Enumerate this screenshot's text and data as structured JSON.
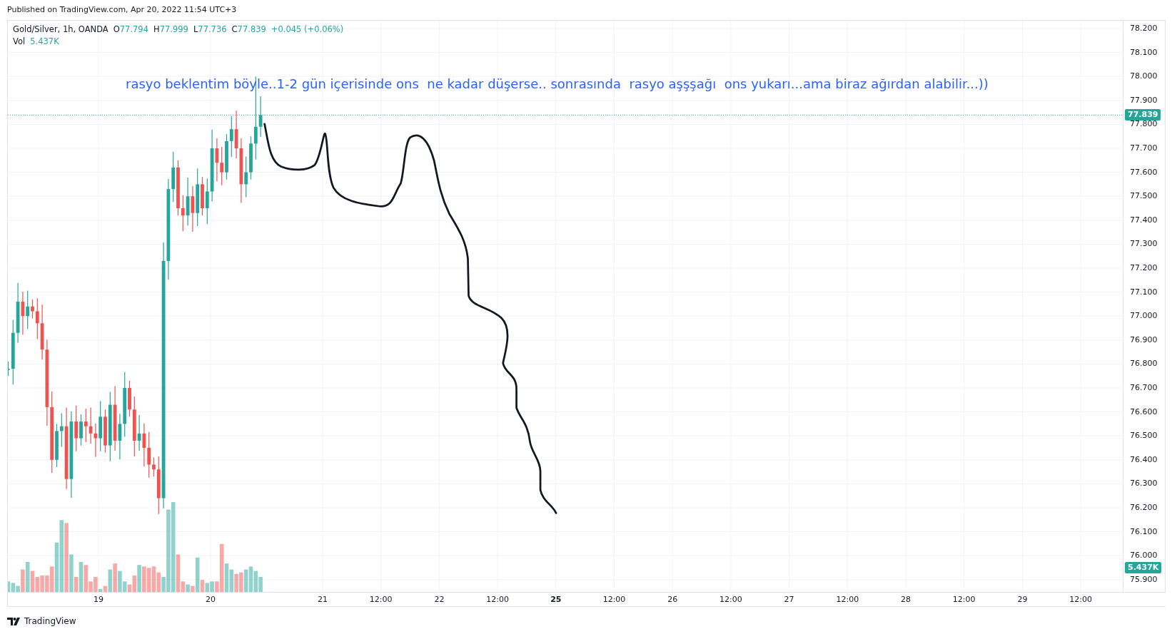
{
  "published": "Published on TradingView.com, Apr 20, 2022 11:54 UTC+3",
  "legend": {
    "symbol": "Gold/Silver, 1h, OANDA",
    "ohlc": [
      {
        "label": "O",
        "value": "77.794"
      },
      {
        "label": "H",
        "value": "77.999"
      },
      {
        "label": "L",
        "value": "77.736"
      },
      {
        "label": "C",
        "value": "77.839"
      }
    ],
    "change": "+0.045 (+0.06%)",
    "volume_label": "Vol",
    "volume_value": "5.437K"
  },
  "annotation": "rasyo beklentim böyle..1-2 gün içerisinde ons  ne kadar düşerse.. sonrasında  rasyo aşşşağı  ons yukarı...ama biraz ağırdan alabilir...))",
  "price_axis": [
    "78.200",
    "78.100",
    "78.000",
    "77.900",
    "77.800",
    "77.700",
    "77.600",
    "77.500",
    "77.400",
    "77.300",
    "77.200",
    "77.100",
    "77.000",
    "76.900",
    "76.800",
    "76.700",
    "76.600",
    "76.500",
    "76.400",
    "76.300",
    "76.200",
    "76.100",
    "76.000",
    "75.900"
  ],
  "price_badge": "77.839",
  "volume_badge": "5.437K",
  "time_axis": [
    {
      "label": "19",
      "bold": false
    },
    {
      "label": "20",
      "bold": false
    },
    {
      "label": "21",
      "bold": false
    },
    {
      "label": "12:00",
      "bold": false
    },
    {
      "label": "22",
      "bold": false
    },
    {
      "label": "12:00",
      "bold": false
    },
    {
      "label": "25",
      "bold": true
    },
    {
      "label": "12:00",
      "bold": false
    },
    {
      "label": "26",
      "bold": false
    },
    {
      "label": "12:00",
      "bold": false
    },
    {
      "label": "27",
      "bold": false
    },
    {
      "label": "12:00",
      "bold": false
    },
    {
      "label": "28",
      "bold": false
    },
    {
      "label": "12:00",
      "bold": false
    },
    {
      "label": "29",
      "bold": false
    },
    {
      "label": "12:00",
      "bold": false
    }
  ],
  "footer": {
    "brand": "TradingView"
  }
}
